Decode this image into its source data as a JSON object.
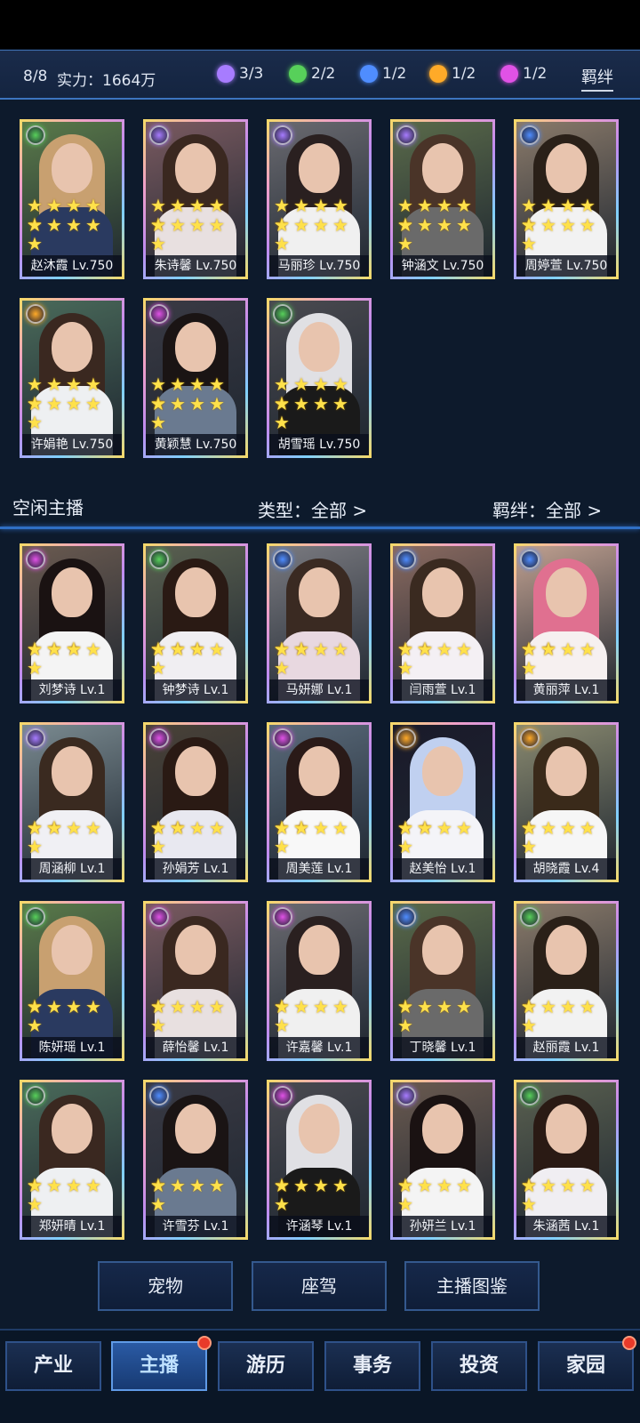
{
  "header": {
    "count": "8/8",
    "power": "实力：1664万",
    "elements": [
      {
        "icon": "purple-element-icon",
        "value": "3/3",
        "color": "#a77cff"
      },
      {
        "icon": "green-element-icon",
        "value": "2/2",
        "color": "#57d05a"
      },
      {
        "icon": "blue-element-icon",
        "value": "1/2",
        "color": "#4f8dff"
      },
      {
        "icon": "orange-element-icon",
        "value": "1/2",
        "color": "#ffaa28"
      },
      {
        "icon": "magenta-element-icon",
        "value": "1/2",
        "color": "#e052e6"
      }
    ],
    "bond_button": "羁绊"
  },
  "active_streamers": [
    {
      "label": "赵沐霞 Lv.750",
      "element": "green",
      "stars": 10
    },
    {
      "label": "朱诗馨 Lv.750",
      "element": "purple",
      "stars": 10
    },
    {
      "label": "马丽珍 Lv.750",
      "element": "purple",
      "stars": 10
    },
    {
      "label": "钟涵文 Lv.750",
      "element": "purple",
      "stars": 10
    },
    {
      "label": "周婷萱 Lv.750",
      "element": "blue",
      "stars": 10
    },
    {
      "label": "许娟艳 Lv.750",
      "element": "orange",
      "stars": 10
    },
    {
      "label": "黄颖慧 Lv.750",
      "element": "magenta",
      "stars": 10
    },
    {
      "label": "胡雪瑶 Lv.750",
      "element": "green",
      "stars": 10
    }
  ],
  "idle_section": {
    "title": "空闲主播",
    "type_filter": "类型：全部 >",
    "bond_filter": "羁绊：全部 >"
  },
  "idle_streamers": [
    {
      "label": "刘梦诗 Lv.1",
      "element": "magenta",
      "stars": 8
    },
    {
      "label": "钟梦诗 Lv.1",
      "element": "green",
      "stars": 8
    },
    {
      "label": "马妍娜 Lv.1",
      "element": "blue",
      "stars": 7
    },
    {
      "label": "闫雨萱 Lv.1",
      "element": "blue",
      "stars": 7
    },
    {
      "label": "黄丽萍 Lv.1",
      "element": "blue",
      "stars": 7
    },
    {
      "label": "周涵柳 Lv.1",
      "element": "purple",
      "stars": 7
    },
    {
      "label": "孙娟芳 Lv.1",
      "element": "magenta",
      "stars": 7
    },
    {
      "label": "周美莲 Lv.1",
      "element": "magenta",
      "stars": 7
    },
    {
      "label": "赵美怡 Lv.1",
      "element": "orange",
      "stars": 7
    },
    {
      "label": "胡晓霞 Lv.4",
      "element": "orange",
      "stars": 6
    },
    {
      "label": "陈妍瑶 Lv.1",
      "element": "green",
      "stars": 6
    },
    {
      "label": "薛怡馨 Lv.1",
      "element": "magenta",
      "stars": 6
    },
    {
      "label": "许嘉馨 Lv.1",
      "element": "magenta",
      "stars": 6
    },
    {
      "label": "丁晓馨 Lv.1",
      "element": "blue",
      "stars": 6
    },
    {
      "label": "赵丽霞 Lv.1",
      "element": "green",
      "stars": 6
    },
    {
      "label": "郑妍晴 Lv.1",
      "element": "green",
      "stars": 6
    },
    {
      "label": "许雪芬 Lv.1",
      "element": "blue",
      "stars": 6
    },
    {
      "label": "许涵琴 Lv.1",
      "element": "magenta",
      "stars": 6
    },
    {
      "label": "孙妍兰 Lv.1",
      "element": "purple",
      "stars": 6
    },
    {
      "label": "朱涵茜 Lv.1",
      "element": "green",
      "stars": 6
    }
  ],
  "actions": [
    "宠物",
    "座驾",
    "主播图鉴"
  ],
  "tabs": [
    {
      "label": "产业",
      "active": false,
      "badge": false
    },
    {
      "label": "主播",
      "active": true,
      "badge": true
    },
    {
      "label": "游历",
      "active": false,
      "badge": false
    },
    {
      "label": "事务",
      "active": false,
      "badge": false
    },
    {
      "label": "投资",
      "active": false,
      "badge": false
    },
    {
      "label": "家园",
      "active": false,
      "badge": true
    }
  ],
  "element_colors": {
    "green": "#57d05a",
    "purple": "#a77cff",
    "blue": "#4f8dff",
    "orange": "#ffaa28",
    "magenta": "#e052e6"
  }
}
